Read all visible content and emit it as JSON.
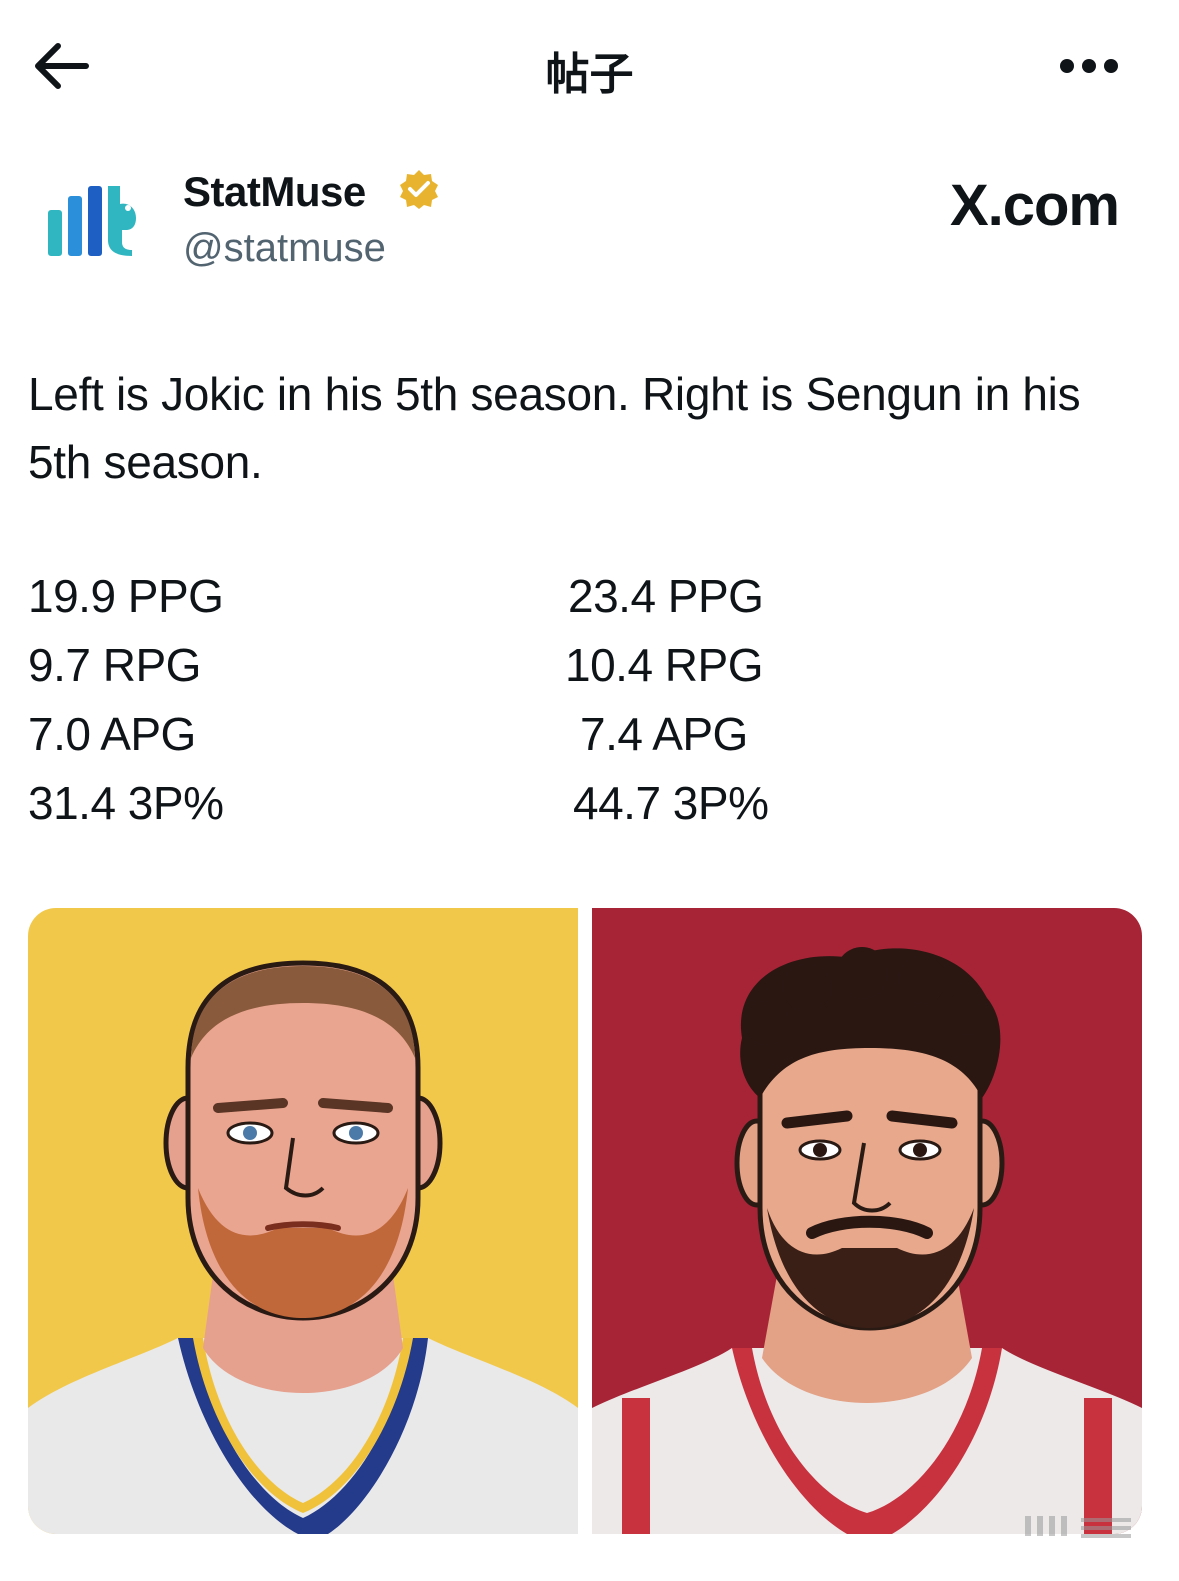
{
  "header": {
    "title": "帖子",
    "back_icon": "arrow-left-icon",
    "more_icon": "more-horizontal-icon"
  },
  "author": {
    "name": "StatMuse",
    "handle": "@statmuse",
    "verified_badge": "verified-badge-icon",
    "badge_color": "#e8b430",
    "logo_colors": [
      "#2b8fd9",
      "#1e5fc4",
      "#2fb6c0"
    ]
  },
  "source_label": "X.com",
  "post": {
    "text": "Left is Jokic in his 5th season. Right is Sengun in his 5th season."
  },
  "stats": {
    "left": [
      "19.9 PPG",
      "9.7 RPG",
      "7.0 APG",
      "31.4 3P%"
    ],
    "right": [
      "23.4 PPG",
      "10.4 RPG",
      "7.4 APG",
      "44.7 3P%"
    ]
  },
  "media": {
    "left_background": "#f2c84b",
    "right_background": "#a72437"
  }
}
